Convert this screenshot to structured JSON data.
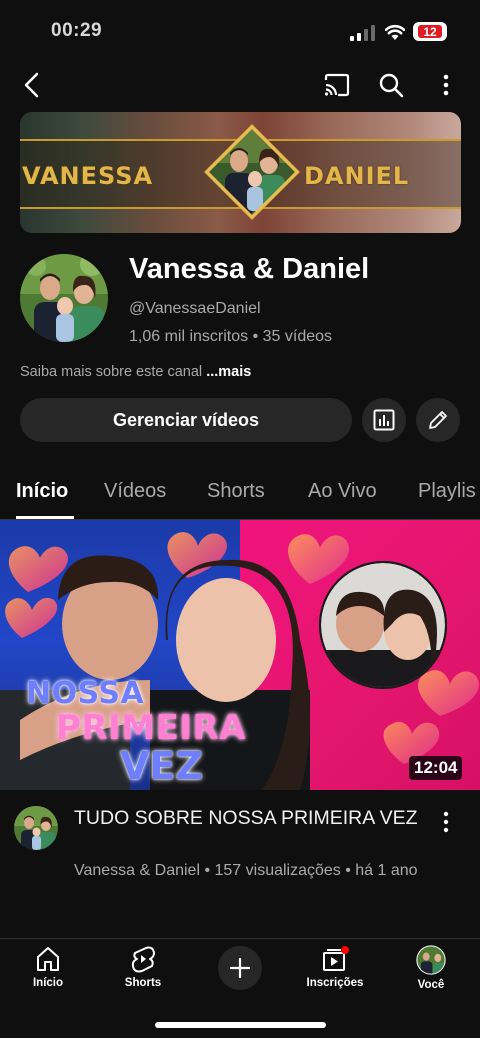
{
  "status_bar": {
    "time": "00:29",
    "battery": "12"
  },
  "banner": {
    "left_name": "VANESSA",
    "right_name": "DANIEL"
  },
  "channel": {
    "name": "Vanessa & Daniel",
    "handle": "@VanessaeDaniel",
    "meta": "1,06 mil inscritos • 35 vídeos",
    "about": "Saiba mais sobre este canal",
    "about_more": "...mais",
    "manage_label": "Gerenciar vídeos"
  },
  "tabs": [
    {
      "label": "Início",
      "active": true
    },
    {
      "label": "Vídeos"
    },
    {
      "label": "Shorts"
    },
    {
      "label": "Ao Vivo"
    },
    {
      "label": "Playlis"
    }
  ],
  "video": {
    "thumb_line1": "NOSSA",
    "thumb_line2": "PRIMEIRA",
    "thumb_line3": "VEZ",
    "duration": "12:04",
    "title": "TUDO SOBRE NOSSA PRIMEIRA VEZ",
    "meta": "Vanessa & Daniel  • 157 visualizações • há 1 ano"
  },
  "bottom_nav": [
    {
      "label": "Início",
      "icon": "home-icon"
    },
    {
      "label": "Shorts",
      "icon": "shorts-icon"
    },
    {
      "label": "",
      "icon": "plus-icon"
    },
    {
      "label": "Inscrições",
      "icon": "subscriptions-icon"
    },
    {
      "label": "Você",
      "icon": "avatar"
    }
  ],
  "colors": {
    "background": "#0f0f0f",
    "button": "#272727",
    "banner_gold": "#e3b64a",
    "accent_red": "#e01b24"
  }
}
